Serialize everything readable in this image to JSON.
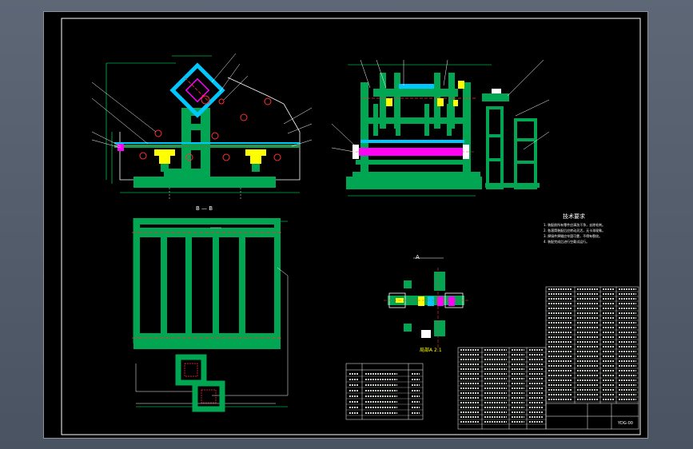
{
  "viewport": {
    "background": "#000000",
    "frame_color": "#ffffff"
  },
  "colors": {
    "structure": "#00a651",
    "rollers": "#ff00ff",
    "bearings": "#ffff00",
    "cyan_bracket": "#00c8ff",
    "red_lines": "#ff3030",
    "dims": "#00ff66",
    "white_lines": "#ffffff",
    "table_lines": "#ffffff"
  },
  "section_labels": {
    "bottom_view": "B — B",
    "detail_a_top": "A",
    "detail_a": "局部A 2:1"
  },
  "tech_requirements": {
    "title": "技术要求",
    "lines": [
      "1. 装配前所有零件应清洗干净，去除毛刺。",
      "2. 各滚筒装配后应转动灵活，无卡滞现象。",
      "3. 焊接件焊缝应牢固可靠，不得有裂纹。",
      "4. 装配完成后进行空载试运行。"
    ]
  },
  "title_block": {
    "drawing_no": "YDG-00"
  }
}
